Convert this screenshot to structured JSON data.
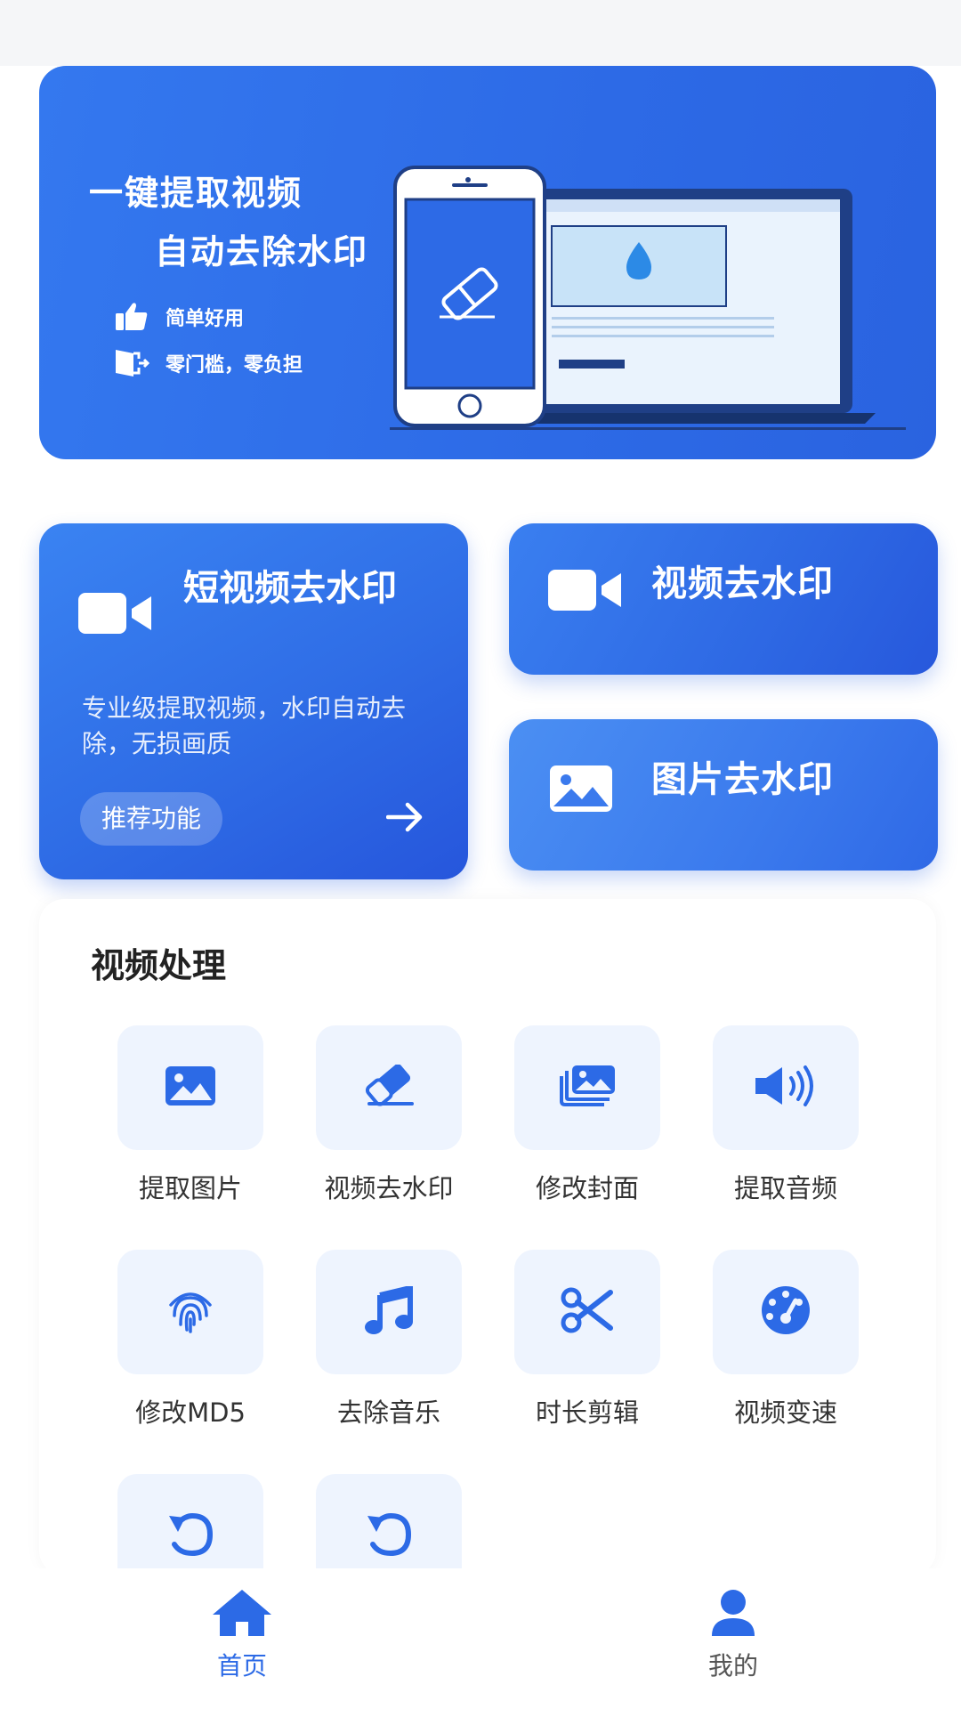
{
  "banner": {
    "title_line1": "一键提取视频",
    "title_line2": "自动去除水印",
    "features": [
      {
        "icon": "thumbs-up-icon",
        "label": "简单好用"
      },
      {
        "icon": "exit-door-icon",
        "label": "零门槛，零负担"
      }
    ]
  },
  "cards": {
    "short_video": {
      "title": "短视频去水印",
      "description": "专业级提取视频，水印自动去除，无损画质",
      "badge": "推荐功能",
      "icon": "video-camera-icon"
    },
    "video": {
      "label": "视频去水印",
      "icon": "video-camera-icon"
    },
    "image": {
      "label": "图片去水印",
      "icon": "image-icon"
    }
  },
  "video_processing": {
    "title": "视频处理",
    "tools": [
      {
        "label": "提取图片",
        "icon": "image-icon"
      },
      {
        "label": "视频去水印",
        "icon": "eraser-icon"
      },
      {
        "label": "修改封面",
        "icon": "photo-stack-icon"
      },
      {
        "label": "提取音频",
        "icon": "speaker-icon"
      },
      {
        "label": "修改MD5",
        "icon": "fingerprint-icon"
      },
      {
        "label": "去除音乐",
        "icon": "music-note-icon"
      },
      {
        "label": "时长剪辑",
        "icon": "scissors-icon"
      },
      {
        "label": "视频变速",
        "icon": "speedometer-icon"
      },
      {
        "label": "",
        "icon": "rotate-icon"
      },
      {
        "label": "",
        "icon": "rotate-icon"
      }
    ]
  },
  "bottom_nav": {
    "items": [
      {
        "label": "首页",
        "icon": "home-icon",
        "active": true
      },
      {
        "label": "我的",
        "icon": "user-icon",
        "active": false
      }
    ]
  },
  "colors": {
    "primary": "#2c6ae6",
    "tool_bg": "#eef4fe",
    "status_bar_bg": "#f5f6f8"
  }
}
